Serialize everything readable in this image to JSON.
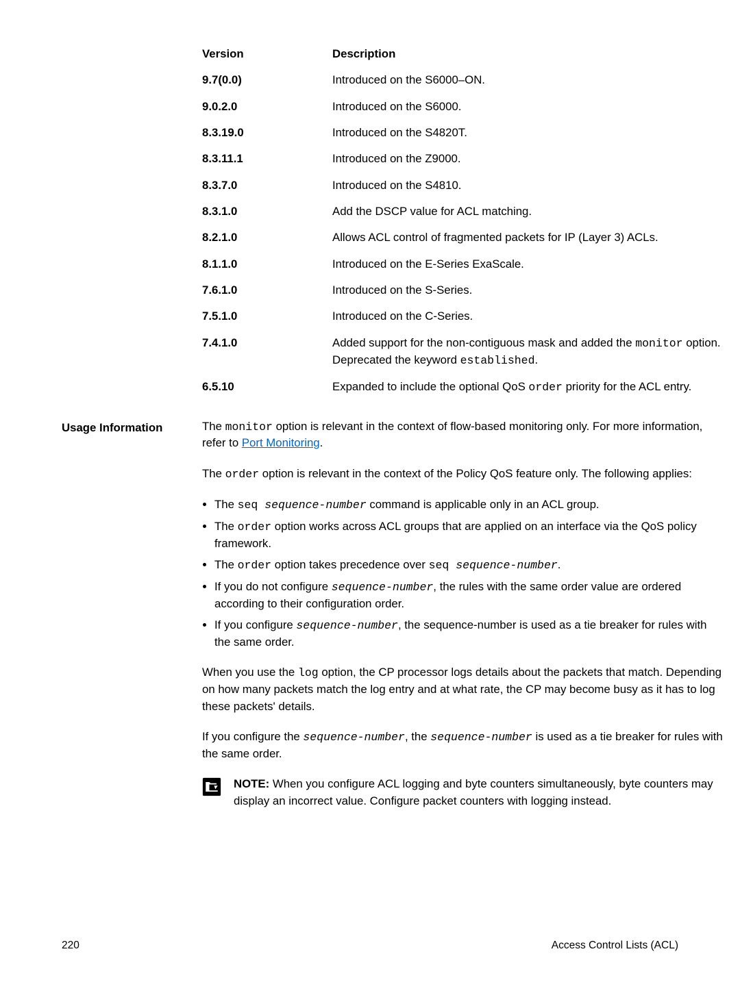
{
  "version_table": {
    "header": {
      "version": "Version",
      "description": "Description"
    },
    "rows": [
      {
        "version": "9.7(0.0)",
        "description": "Introduced on the S6000–ON."
      },
      {
        "version": "9.0.2.0",
        "description": "Introduced on the S6000."
      },
      {
        "version": "8.3.19.0",
        "description": "Introduced on the S4820T."
      },
      {
        "version": "8.3.11.1",
        "description": "Introduced on the Z9000."
      },
      {
        "version": "8.3.7.0",
        "description": "Introduced on the S4810."
      },
      {
        "version": "8.3.1.0",
        "description": "Add the DSCP value for ACL matching."
      },
      {
        "version": "8.2.1.0",
        "description": "Allows ACL control of fragmented packets for IP (Layer 3) ACLs."
      },
      {
        "version": "8.1.1.0",
        "description": "Introduced on the E-Series ExaScale."
      },
      {
        "version": "7.6.1.0",
        "description": "Introduced on the S-Series."
      },
      {
        "version": "7.5.1.0",
        "description": "Introduced on the C-Series."
      },
      {
        "version": "7.4.1.0",
        "description": "Added support for the non-contiguous mask and added the ",
        "code1": "monitor",
        "tail1": " option. Deprecated the keyword ",
        "code2": "established",
        "tail2": "."
      },
      {
        "version": "6.5.10",
        "description": "Expanded to include the optional QoS ",
        "code1": "order",
        "tail1": " priority for the ACL entry."
      }
    ]
  },
  "usage": {
    "label": "Usage Information",
    "para1_a": "The ",
    "para1_code": "monitor",
    "para1_b": " option is relevant in the context of flow-based monitoring only. For more information, refer to ",
    "para1_link": "Port Monitoring",
    "para1_c": ".",
    "para2_a": "The ",
    "para2_code": "order",
    "para2_b": " option is relevant in the context of the Policy QoS feature only. The following applies:",
    "bullets": {
      "b1_a": "The ",
      "b1_code1": "seq ",
      "b1_code2": "sequence-number",
      "b1_b": " command is applicable only in an ACL group.",
      "b2_a": "The ",
      "b2_code": "order",
      "b2_b": " option works across ACL groups that are applied on an interface via the QoS policy framework.",
      "b3_a": "The ",
      "b3_code1": "order",
      "b3_b": " option takes precedence over ",
      "b3_code2": "seq ",
      "b3_code3": "sequence-number",
      "b3_c": ".",
      "b4_a": "If you do not configure ",
      "b4_code": "sequence-number",
      "b4_b": ", the rules with the same order value are ordered according to their configuration order.",
      "b5_a": "If you configure ",
      "b5_code": "sequence-number",
      "b5_b": ", the sequence-number is used as a tie breaker for rules with the same order."
    },
    "para3_a": "When you use the ",
    "para3_code": "log",
    "para3_b": " option, the CP processor logs details about the packets that match. Depending on how many packets match the log entry and at what rate, the CP may become busy as it has to log these packets' details.",
    "para4_a": "If you configure the ",
    "para4_code1": "sequence-number",
    "para4_b": ", the ",
    "para4_code2": "sequence-number",
    "para4_c": " is used as a tie breaker for rules with the same order.",
    "note_label": "NOTE: ",
    "note_body": "When you configure ACL logging and byte counters simultaneously, byte counters may display an incorrect value. Configure packet counters with logging instead."
  },
  "footer": {
    "page": "220",
    "title": "Access Control Lists (ACL)"
  }
}
